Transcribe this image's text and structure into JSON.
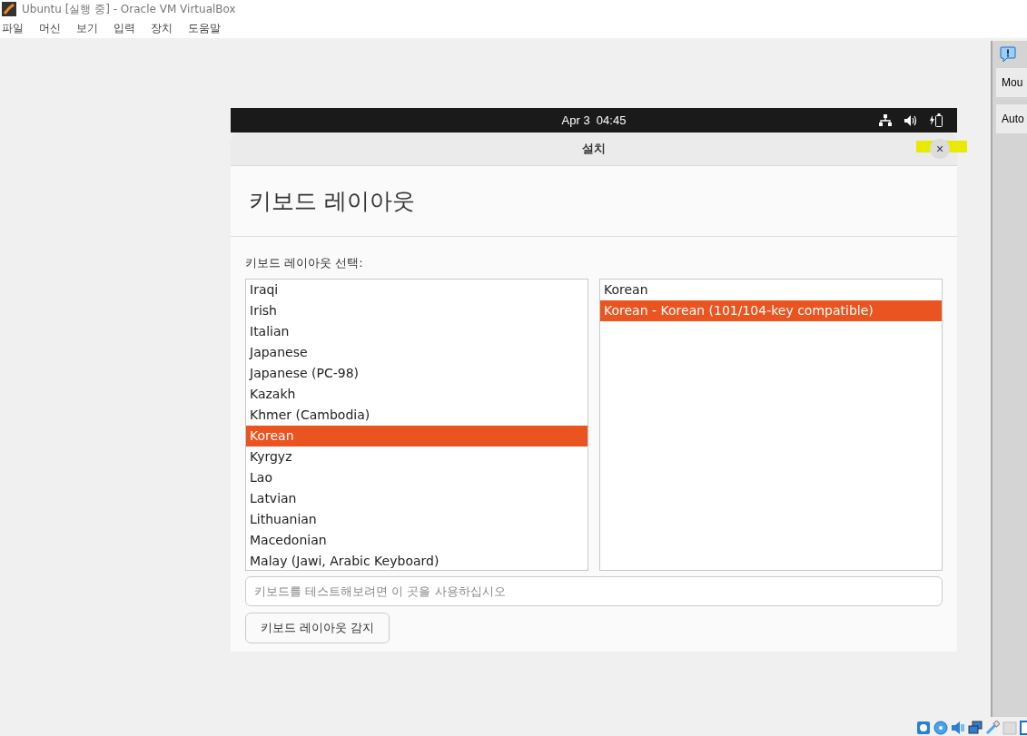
{
  "window": {
    "title": "Ubuntu [실행 중] - Oracle VM VirtualBox"
  },
  "menu": [
    "파일",
    "머신",
    "보기",
    "입력",
    "장치",
    "도움말"
  ],
  "vm_top_bar": {
    "clock": "Apr 3  04:45"
  },
  "dialog": {
    "title": "설치",
    "close": "×",
    "heading": "키보드 레이아웃",
    "list_label": "키보드 레이아웃 선택:",
    "layouts": [
      {
        "label": "Iraqi",
        "selected": false
      },
      {
        "label": "Irish",
        "selected": false
      },
      {
        "label": "Italian",
        "selected": false
      },
      {
        "label": "Japanese",
        "selected": false
      },
      {
        "label": "Japanese (PC-98)",
        "selected": false
      },
      {
        "label": "Kazakh",
        "selected": false
      },
      {
        "label": "Khmer (Cambodia)",
        "selected": false
      },
      {
        "label": "Korean",
        "selected": true
      },
      {
        "label": "Kyrgyz",
        "selected": false
      },
      {
        "label": "Lao",
        "selected": false
      },
      {
        "label": "Latvian",
        "selected": false
      },
      {
        "label": "Lithuanian",
        "selected": false
      },
      {
        "label": "Macedonian",
        "selected": false
      },
      {
        "label": "Malay (Jawi, Arabic Keyboard)",
        "selected": false
      }
    ],
    "variants": [
      {
        "label": "Korean",
        "selected": false
      },
      {
        "label": "Korean - Korean (101/104-key compatible)",
        "selected": true
      }
    ],
    "test_field": {
      "placeholder": "키보드를 테스트해보려면 이 곳을 사용하십시오"
    },
    "detect_button": "키보드 레이아웃 감지"
  },
  "side_panel": {
    "buttons": [
      "Mou",
      "Auto"
    ]
  }
}
